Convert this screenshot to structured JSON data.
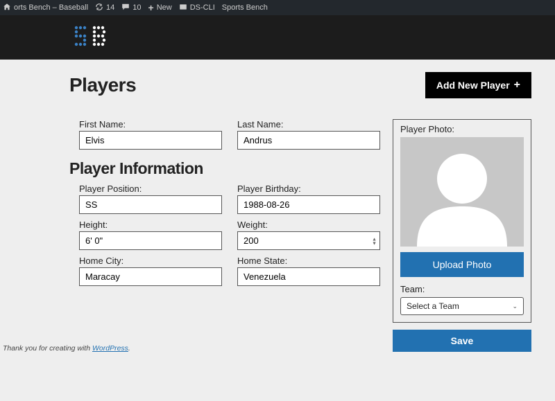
{
  "adminbar": {
    "site_name": "orts Bench – Baseball",
    "updates_count": "14",
    "comments_count": "10",
    "new_label": "New",
    "dscli_label": "DS-CLI",
    "sports_bench_label": "Sports Bench"
  },
  "page": {
    "title": "Players",
    "add_button": "Add New Player"
  },
  "labels": {
    "first_name": "First Name:",
    "last_name": "Last Name:",
    "section_info": "Player Information",
    "position": "Player Position:",
    "birthday": "Player Birthday:",
    "height": "Height:",
    "weight": "Weight:",
    "home_city": "Home City:",
    "home_state": "Home State:",
    "player_photo": "Player Photo:",
    "upload_photo": "Upload Photo",
    "team": "Team:",
    "select_team": "Select a Team",
    "save": "Save"
  },
  "player": {
    "first_name": "Elvis",
    "last_name": "Andrus",
    "position": "SS",
    "birthday": "1988-08-26",
    "height": "6' 0\"",
    "weight": "200",
    "home_city": "Maracay",
    "home_state": "Venezuela"
  },
  "footer": {
    "thanks_prefix": "Thank you for creating with ",
    "wp_link": "WordPress",
    "suffix": "."
  }
}
